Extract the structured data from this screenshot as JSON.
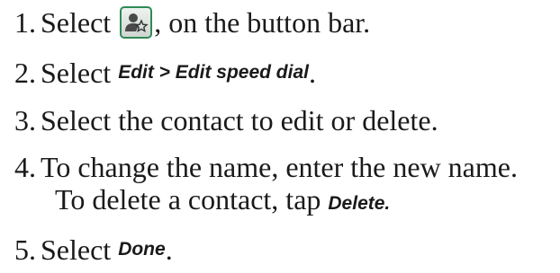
{
  "steps": [
    {
      "number": "1.",
      "text_before": "Select ",
      "icon": "contact-star-icon",
      "text_after": ", on the button bar."
    },
    {
      "number": "2.",
      "text_before": "Select ",
      "ui_label": "Edit > Edit speed dial",
      "text_after": "."
    },
    {
      "number": "3.",
      "text": "Select the contact to edit or delete."
    },
    {
      "number": "4.",
      "text": "To change the name, enter the new name.",
      "line2_before": "To delete a contact, tap ",
      "ui_label": "Delete."
    },
    {
      "number": "5.",
      "text_before": "Select ",
      "ui_label": "Done",
      "text_after": "."
    }
  ],
  "colors": {
    "icon_border": "#2f8a55",
    "text": "#1a1a1a"
  }
}
